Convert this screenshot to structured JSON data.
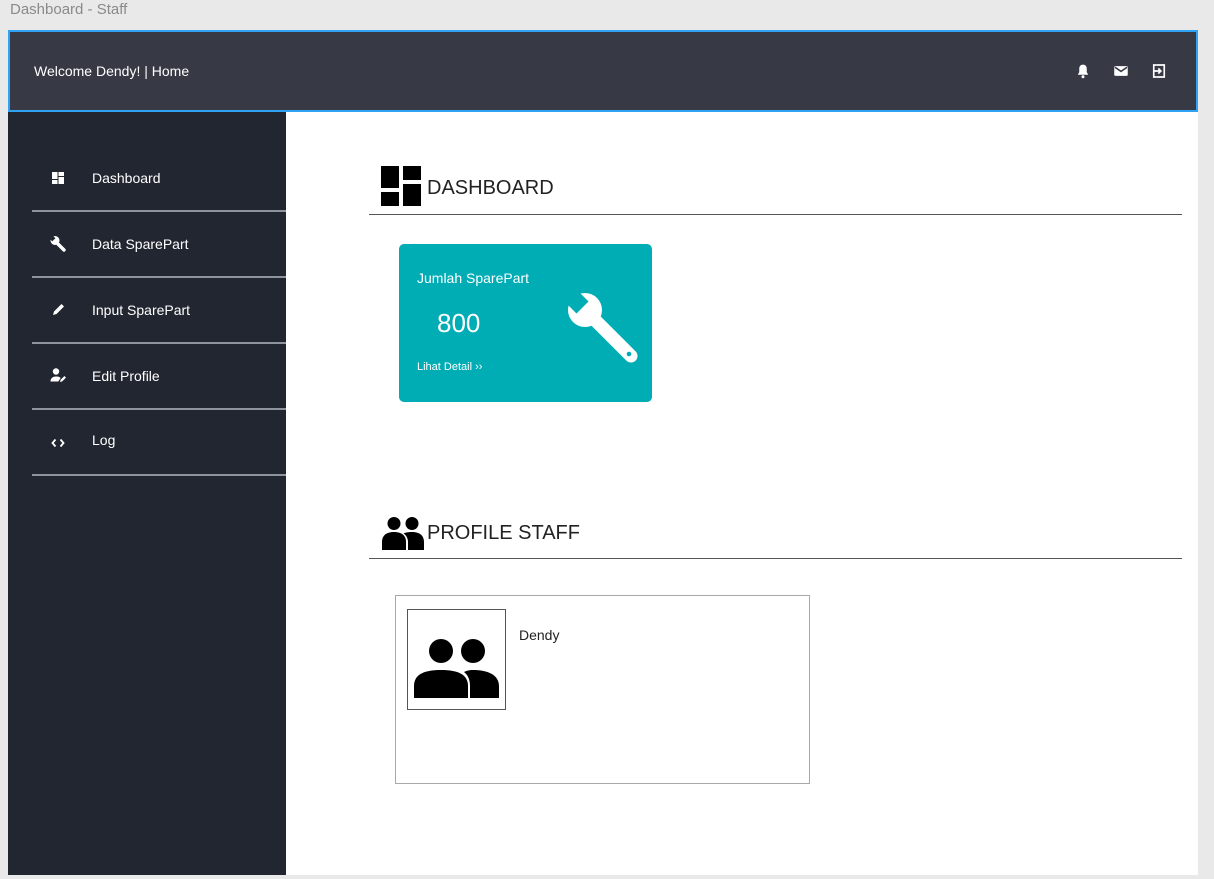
{
  "window": {
    "title": "Dashboard - Staff"
  },
  "topbar": {
    "welcome": "Welcome Dendy! | Home",
    "icons": [
      "bell-icon",
      "mail-icon",
      "logout-icon"
    ]
  },
  "sidebar": {
    "items": [
      {
        "label": "Dashboard",
        "icon": "dashboard-icon"
      },
      {
        "label": "Data SparePart",
        "icon": "wrench-icon"
      },
      {
        "label": "Input SparePart",
        "icon": "pencil-icon"
      },
      {
        "label": "Edit Profile",
        "icon": "user-edit-icon"
      },
      {
        "label": "Log",
        "icon": "code-icon"
      }
    ]
  },
  "main": {
    "dashboard_title": "DASHBOARD",
    "card": {
      "caption": "Jumlah SparePart",
      "value": "800",
      "link": "Lihat Detail ››",
      "color": "#00adb5",
      "icon": "wrench-icon"
    },
    "profile_title": "PROFILE STAFF",
    "profile": {
      "name": "Dendy",
      "avatar_icon": "people-icon"
    }
  },
  "colors": {
    "topbar": "#373a45",
    "topbar_border": "#2fa2f3",
    "sidebar": "#222630",
    "card": "#00adb5"
  }
}
